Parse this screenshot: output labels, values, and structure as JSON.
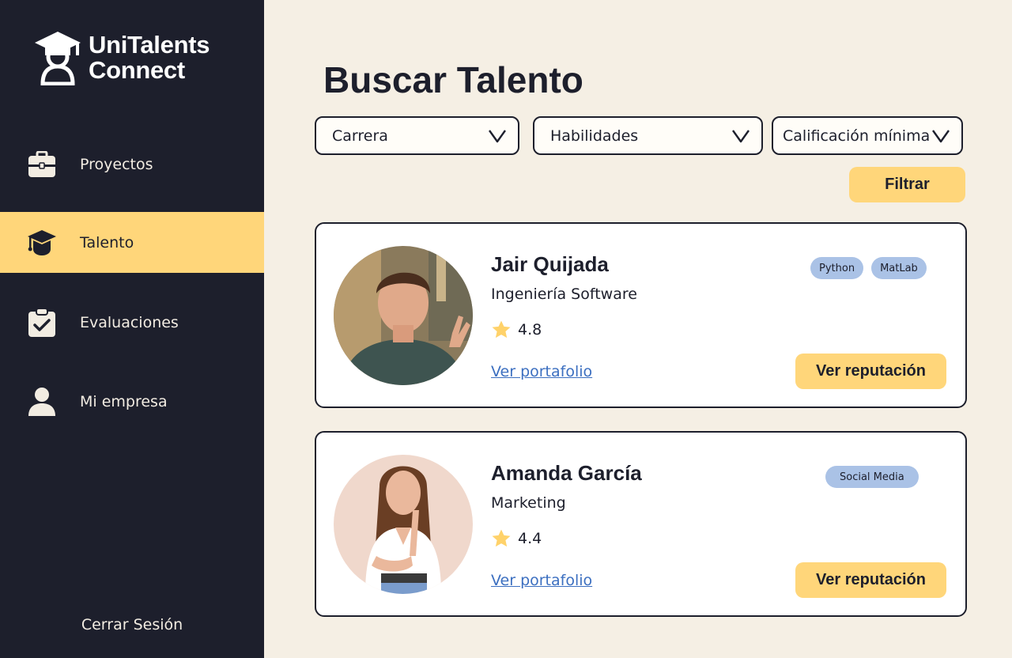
{
  "brand": {
    "line1": "UniTalents",
    "line2": "Connect"
  },
  "sidebar": {
    "items": [
      {
        "label": "Proyectos",
        "icon": "briefcase-icon",
        "active": false
      },
      {
        "label": "Talento",
        "icon": "graduation-cap-icon",
        "active": true
      },
      {
        "label": "Evaluaciones",
        "icon": "clipboard-check-icon",
        "active": false
      },
      {
        "label": "Mi empresa",
        "icon": "user-icon",
        "active": false
      }
    ],
    "logout_label": "Cerrar Sesión"
  },
  "main": {
    "title": "Buscar Talento",
    "filters": [
      {
        "label": "Carrera"
      },
      {
        "label": "Habilidades"
      },
      {
        "label": "Calificación mínima"
      }
    ],
    "filter_button": "Filtrar"
  },
  "profiles": [
    {
      "name": "Jair Quijada",
      "career": "Ingeniería Software",
      "rating": "4.8",
      "portfolio_link": "Ver portafolio",
      "tags": [
        "Python",
        "MatLab"
      ],
      "reputation_button": "Ver reputación"
    },
    {
      "name": "Amanda García",
      "career": "Marketing",
      "rating": "4.4",
      "portfolio_link": "Ver portafolio",
      "tags": [
        "Social Media"
      ],
      "reputation_button": "Ver reputación"
    }
  ],
  "colors": {
    "sidebar_bg": "#1d1f2c",
    "accent": "#ffd67a",
    "page_bg": "#f5efe4",
    "tag_bg": "#aac2e6",
    "link": "#3c6fc0",
    "star": "#ffd26a"
  }
}
